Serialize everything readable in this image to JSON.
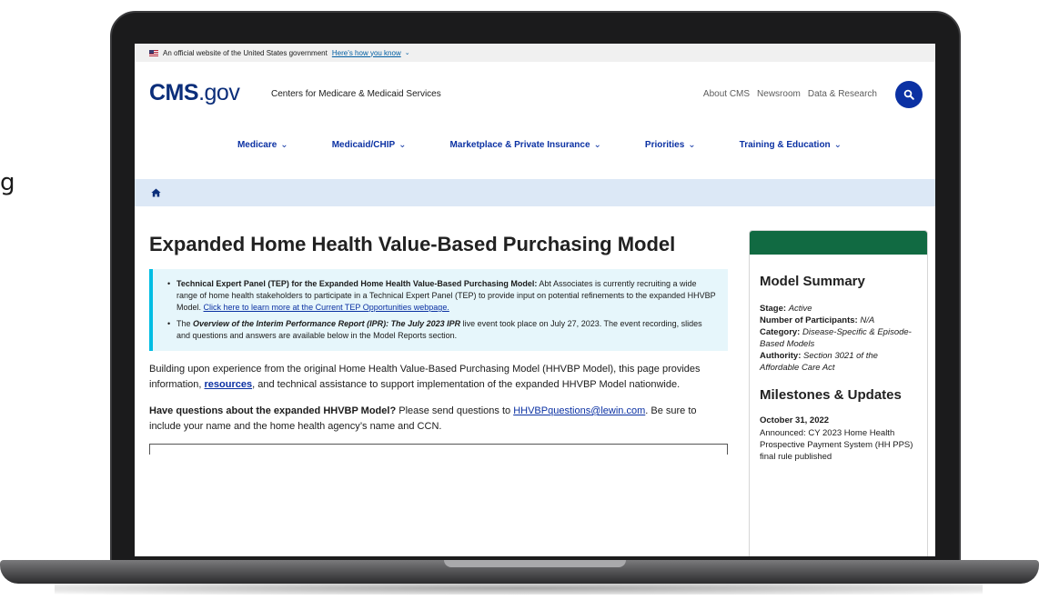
{
  "gov_banner": {
    "text": "An official website of the United States government",
    "link": "Here’s how you know"
  },
  "header": {
    "logo_cms": "CMS",
    "logo_gov": ".gov",
    "tagline": "Centers for Medicare & Medicaid Services",
    "util_links": [
      "About CMS",
      "Newsroom",
      "Data & Research"
    ]
  },
  "nav": {
    "items": [
      {
        "label": "Medicare"
      },
      {
        "label": "Medicaid/CHIP"
      },
      {
        "label": "Marketplace & Private Insurance"
      },
      {
        "label": "Priorities"
      },
      {
        "label": "Training & Education"
      }
    ]
  },
  "edge_text": "g",
  "main": {
    "title": "Expanded Home Health Value-Based Purchasing Model",
    "alert": {
      "item1_bold": "Technical Expert Panel (TEP) for the Expanded Home Health Value-Based Purchasing Model:",
      "item1_text": " Abt Associates is currently recruiting a wide range of home health stakeholders to participate in a Technical Expert Panel (TEP) to provide input on potential refinements to the expanded HHVBP Model. ",
      "item1_link": "Click here to learn more at the Current TEP Opportunities webpage.",
      "item2_pre": "The ",
      "item2_bold": "Overview of the Interim Performance Report (IPR): The July 2023 IPR",
      "item2_text": " live event took place on July 27, 2023. The event recording, slides and questions and answers are available below in the Model Reports section."
    },
    "intro_pre": "Building upon experience from the original Home Health Value-Based Purchasing Model (HHVBP Model), this page provides information, ",
    "intro_link": "resources",
    "intro_post": ", and technical assistance to support implementation of the expanded HHVBP Model nationwide.",
    "questions_bold": "Have questions about the expanded HHVBP Model?",
    "questions_pre": " Please send questions to ",
    "questions_email": "HHVBPquestions@lewin.com",
    "questions_post": ". Be sure to include your name and the home health agency’s name and CCN."
  },
  "sidebar": {
    "summary_title": "Model Summary",
    "stage_label": "Stage:",
    "stage_value": "Active",
    "participants_label": "Number of Participants:",
    "participants_value": "N/A",
    "category_label": "Category:",
    "category_value": "Disease-Specific & Episode-Based Models",
    "authority_label": "Authority:",
    "authority_value": "Section 3021 of the Affordable Care Act",
    "milestones_title": "Milestones & Updates",
    "milestone_date": "October 31, 2022",
    "milestone_text": "Announced: CY 2023 Home Health Prospective Payment System (HH PPS) final rule published"
  },
  "colors": {
    "brand_blue": "#0b31a3",
    "logo_navy": "#0b2e7a",
    "sidebar_green": "#116a42",
    "alert_bg": "#e6f6fb",
    "alert_border": "#00bde3",
    "breadcrumb_bg": "#dce8f6"
  },
  "icons": [
    "us-flag-icon",
    "chevron-down-icon",
    "search-icon",
    "home-icon"
  ]
}
